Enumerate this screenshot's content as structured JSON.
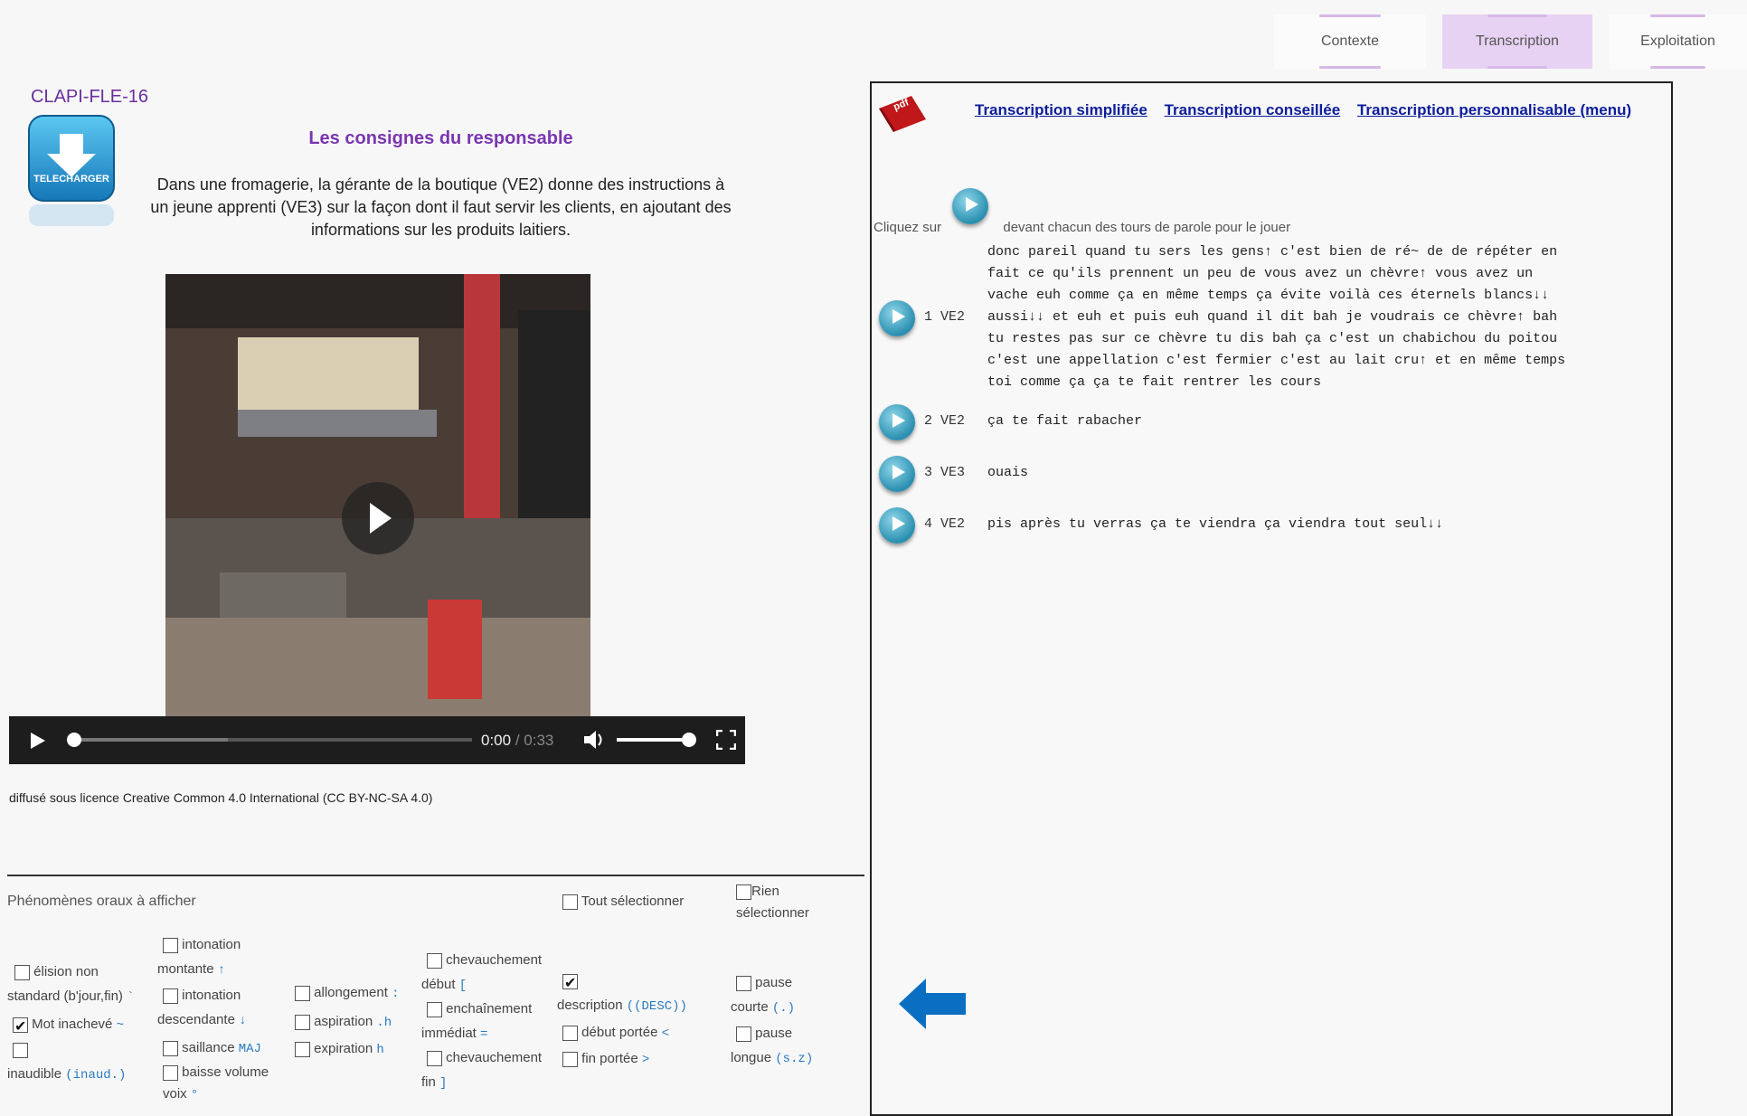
{
  "tabs": [
    {
      "label": "Contexte"
    },
    {
      "label": "Transcription"
    },
    {
      "label": "Exploitation"
    }
  ],
  "left": {
    "code": "CLAPI-FLE-16",
    "download_label": "TELECHARGER",
    "heading": "Les consignes du responsable",
    "description_lines": [
      "Dans une fromagerie, la gérante de la boutique (VE2) donne des instructions à",
      "un jeune apprenti (VE3) sur la façon dont il faut servir les clients, en ajoutant des",
      "informations sur les produits laitiers."
    ],
    "video": {
      "time_current": "0:00",
      "time_total": "0:33",
      "progress": 0.0,
      "volume": 1.0
    },
    "license": "diffusé sous licence Creative Common 4.0 International (CC BY-NC-SA 4.0)"
  },
  "phenomena": {
    "title": "Phénomènes oraux à afficher",
    "select_all": "Tout sélectionner",
    "select_none_1": "Rien",
    "select_none_2": "sélectionner",
    "options": {
      "elision_1": "élision non",
      "elision_2": "standard (b'jour,fin)",
      "elision_sym": "`",
      "mot_inacheve": "Mot inachevé",
      "mot_inacheve_sym": "~",
      "inaudible": "inaudible",
      "inaudible_sym": "(inaud.)",
      "into_mont_1": "intonation",
      "into_mont_2": "montante",
      "into_mont_sym": "↑",
      "into_desc_1": "intonation",
      "into_desc_2": "descendante",
      "into_desc_sym": "↓",
      "saillance": "saillance",
      "saillance_sym": "MAJ",
      "baisse_1": "baisse volume",
      "baisse_2": "voix",
      "baisse_sym": "°",
      "allongement": "allongement",
      "allongement_sym": ":",
      "aspiration": "aspiration",
      "aspiration_sym": ".h",
      "expiration": "expiration",
      "expiration_sym": "h",
      "chev_debut_1": "chevauchement",
      "chev_debut_2": "début",
      "chev_debut_sym": "[",
      "enchainement_1": "enchaînement",
      "enchainement_2": "immédiat",
      "enchainement_sym": "=",
      "chev_fin_1": "chevauchement",
      "chev_fin_2": "fin",
      "chev_fin_sym": "]",
      "description": "description",
      "description_sym": "((DESC))",
      "debut_portee": "début portée",
      "debut_portee_sym": "<",
      "fin_portee": "fin portée",
      "fin_portee_sym": ">",
      "pause_courte_1": "pause",
      "pause_courte_2": "courte",
      "pause_courte_sym": "(.)",
      "pause_longue_1": "pause",
      "pause_longue_2": "longue",
      "pause_longue_sym": "(s.z)"
    },
    "checked": [
      "mot_inacheve",
      "description"
    ]
  },
  "transcript": {
    "pdf_label": "pdf",
    "links": [
      "Transcription simplifiée",
      "Transcription conseillée",
      "Transcription personnalisable (menu)"
    ],
    "hint_before": "Cliquez sur",
    "hint_after": "devant chacun des tours de parole pour le jouer",
    "play_icon_label": "PLAY",
    "turns": [
      {
        "num": "1",
        "speaker": "VE2",
        "lines": [
          "donc pareil quand tu sers les gens↑ c'est bien de ré~ de de répéter en",
          "fait ce qu'ils prennent un peu de vous avez un chèvre↑ vous avez un",
          "vache euh comme ça en même temps ça évite voilà ces éternels blancs↓↓",
          "aussi↓↓ et euh et puis euh quand il dit bah je voudrais ce chèvre↑ bah",
          "tu restes pas sur ce chèvre tu dis bah ça c'est un chabichou du poitou",
          "c'est une appellation c'est fermier c'est au lait cru↑ et en même temps",
          "toi comme ça ça te fait rentrer les cours"
        ]
      },
      {
        "num": "2",
        "speaker": "VE2",
        "lines": [
          "ça te fait rabacher"
        ]
      },
      {
        "num": "3",
        "speaker": "VE3",
        "lines": [
          "ouais"
        ]
      },
      {
        "num": "4",
        "speaker": "VE2",
        "lines": [
          "pis après tu verras ça te viendra ça viendra tout seul↓↓"
        ]
      }
    ]
  },
  "colors": {
    "accent": "#7a36b0",
    "link": "#0d1e9a",
    "play": "#2a8fb0",
    "arrow": "#0a6fc2"
  }
}
